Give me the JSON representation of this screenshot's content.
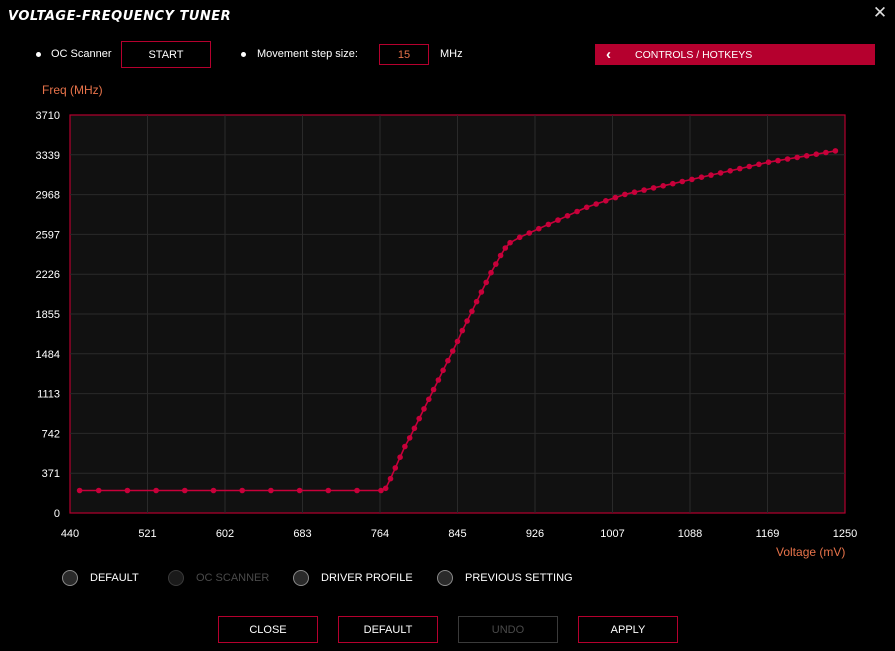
{
  "window": {
    "title": "VOLTAGE-FREQUENCY TUNER",
    "close_icon": "close-icon"
  },
  "toolbar": {
    "oc_scanner_label": "OC Scanner",
    "start_label": "START",
    "step_label": "Movement step size:",
    "step_value": "15",
    "step_unit": "MHz",
    "controls_label": "CONTROLS / HOTKEYS"
  },
  "colors": {
    "accent": "#b5002e",
    "axis_title": "#e8734a",
    "plot_bg": "#111111",
    "grid": "#2a2a2a",
    "curve": "#c8003a"
  },
  "chart_data": {
    "type": "line",
    "xlabel": "Voltage (mV)",
    "ylabel": "Freq (MHz)",
    "xlim": [
      440,
      1250
    ],
    "ylim": [
      0,
      3710
    ],
    "x_ticks": [
      "440",
      "521",
      "602",
      "683",
      "764",
      "845",
      "926",
      "1007",
      "1088",
      "1169",
      "1250"
    ],
    "y_ticks": [
      "0",
      "371",
      "742",
      "1113",
      "1484",
      "1855",
      "2226",
      "2597",
      "2968",
      "3339",
      "3710"
    ],
    "grid": true,
    "series": [
      {
        "points": [
          [
            450,
            210
          ],
          [
            470,
            210
          ],
          [
            500,
            210
          ],
          [
            530,
            210
          ],
          [
            560,
            210
          ],
          [
            590,
            210
          ],
          [
            620,
            210
          ],
          [
            650,
            210
          ],
          [
            680,
            210
          ],
          [
            710,
            210
          ],
          [
            740,
            210
          ],
          [
            765,
            210
          ],
          [
            770,
            230
          ],
          [
            775,
            320
          ],
          [
            780,
            420
          ],
          [
            785,
            520
          ],
          [
            790,
            620
          ],
          [
            795,
            700
          ],
          [
            800,
            790
          ],
          [
            805,
            880
          ],
          [
            810,
            970
          ],
          [
            815,
            1060
          ],
          [
            820,
            1150
          ],
          [
            825,
            1240
          ],
          [
            830,
            1330
          ],
          [
            835,
            1420
          ],
          [
            840,
            1510
          ],
          [
            845,
            1600
          ],
          [
            850,
            1700
          ],
          [
            855,
            1790
          ],
          [
            860,
            1880
          ],
          [
            865,
            1970
          ],
          [
            870,
            2060
          ],
          [
            875,
            2150
          ],
          [
            880,
            2240
          ],
          [
            885,
            2320
          ],
          [
            890,
            2400
          ],
          [
            895,
            2470
          ],
          [
            900,
            2520
          ],
          [
            910,
            2570
          ],
          [
            920,
            2610
          ],
          [
            930,
            2650
          ],
          [
            940,
            2690
          ],
          [
            950,
            2730
          ],
          [
            960,
            2770
          ],
          [
            970,
            2810
          ],
          [
            980,
            2850
          ],
          [
            990,
            2880
          ],
          [
            1000,
            2910
          ],
          [
            1010,
            2940
          ],
          [
            1020,
            2970
          ],
          [
            1030,
            2990
          ],
          [
            1040,
            3010
          ],
          [
            1050,
            3030
          ],
          [
            1060,
            3050
          ],
          [
            1070,
            3070
          ],
          [
            1080,
            3090
          ],
          [
            1090,
            3110
          ],
          [
            1100,
            3130
          ],
          [
            1110,
            3150
          ],
          [
            1120,
            3170
          ],
          [
            1130,
            3190
          ],
          [
            1140,
            3210
          ],
          [
            1150,
            3230
          ],
          [
            1160,
            3250
          ],
          [
            1170,
            3270
          ],
          [
            1180,
            3285
          ],
          [
            1190,
            3300
          ],
          [
            1200,
            3315
          ],
          [
            1210,
            3330
          ],
          [
            1220,
            3345
          ],
          [
            1230,
            3360
          ],
          [
            1240,
            3375
          ]
        ]
      }
    ]
  },
  "radios": [
    {
      "label": "DEFAULT",
      "enabled": true
    },
    {
      "label": "OC SCANNER",
      "enabled": false
    },
    {
      "label": "DRIVER PROFILE",
      "enabled": true
    },
    {
      "label": "PREVIOUS SETTING",
      "enabled": true
    }
  ],
  "buttons": {
    "close": "CLOSE",
    "default": "DEFAULT",
    "undo": "UNDO",
    "apply": "APPLY"
  }
}
